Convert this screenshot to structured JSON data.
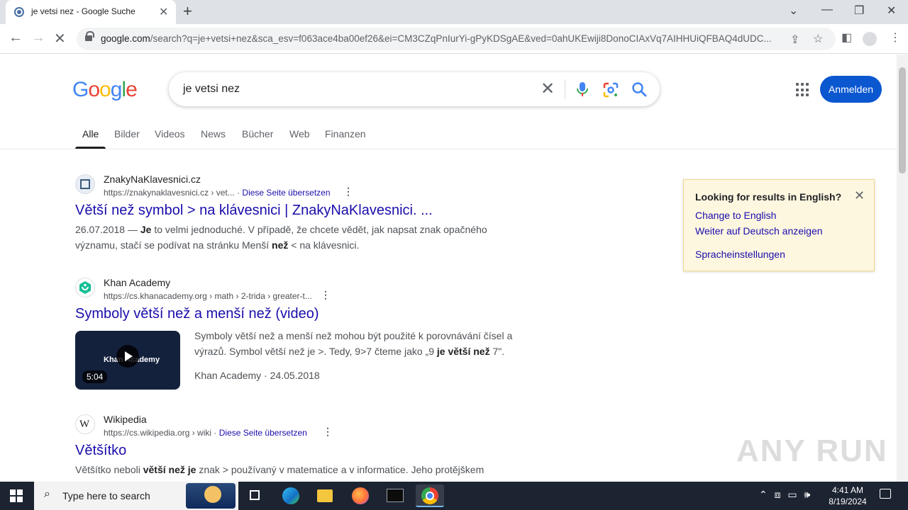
{
  "browser": {
    "tab_title": "je vetsi nez - Google Suche",
    "url_domain": "google.com",
    "url_rest": "/search?q=je+vetsi+nez&sca_esv=f063ace4ba00ef26&ei=CM3CZqPnIurYi-gPyKDSgAE&ved=0ahUKEwiji8DonoCIAxVq7AIHHUiQFBAQ4dUDC..."
  },
  "google": {
    "query": "je vetsi nez",
    "signin_label": "Anmelden",
    "tabs": [
      "Alle",
      "Bilder",
      "Videos",
      "News",
      "Bücher",
      "Web",
      "Finanzen"
    ]
  },
  "results": [
    {
      "site": "ZnakyNaKlavesnici.cz",
      "cite": "https://znakynaklavesnici.cz › vet...",
      "translate": "Diese Seite übersetzen",
      "title": "Větší než symbol > na klávesnici | ZnakyNaKlavesnici. ...",
      "snippet_date": "26.07.2018 — ",
      "snippet_b1": "Je",
      "snippet_t1": " to velmi jednoduché. V případě, že chcete vědět, jak napsat znak opačného významu, stačí se podívat na stránku Menší ",
      "snippet_b2": "než",
      "snippet_t2": " < na klávesnici."
    },
    {
      "site": "Khan Academy",
      "cite": "https://cs.khanacademy.org › math › 2-trida › greater-t...",
      "title": "Symboly větší než a menší než (video)",
      "video_brand": "Khan Academy",
      "video_duration": "5:04",
      "snippet_t1": "Symboly větší než a menší než mohou být použité k porovnávání čísel a výrazů. Symbol větší než je >. Tedy, 9>7 čteme jako „9 ",
      "snippet_b1": "je větší než",
      "snippet_t2": " 7\".",
      "meta_source": "Khan Academy",
      "meta_date": "24.05.2018"
    },
    {
      "site": "Wikipedia",
      "cite": "https://cs.wikipedia.org › wiki",
      "translate": "Diese Seite übersetzen",
      "title": "Většítko",
      "snippet_t1": "Většítko neboli ",
      "snippet_b1": "větší než je",
      "snippet_t2": " znak > používaný v matematice a v informatice. Jeho protějškem"
    }
  ],
  "language_box": {
    "heading": "Looking for results in English?",
    "link1": "Change to English",
    "link2": "Weiter auf Deutsch anzeigen",
    "link3": "Spracheinstellungen"
  },
  "watermark": "ANY RUN",
  "taskbar": {
    "search_placeholder": "Type here to search",
    "time": "4:41 AM",
    "date": "8/19/2024"
  }
}
